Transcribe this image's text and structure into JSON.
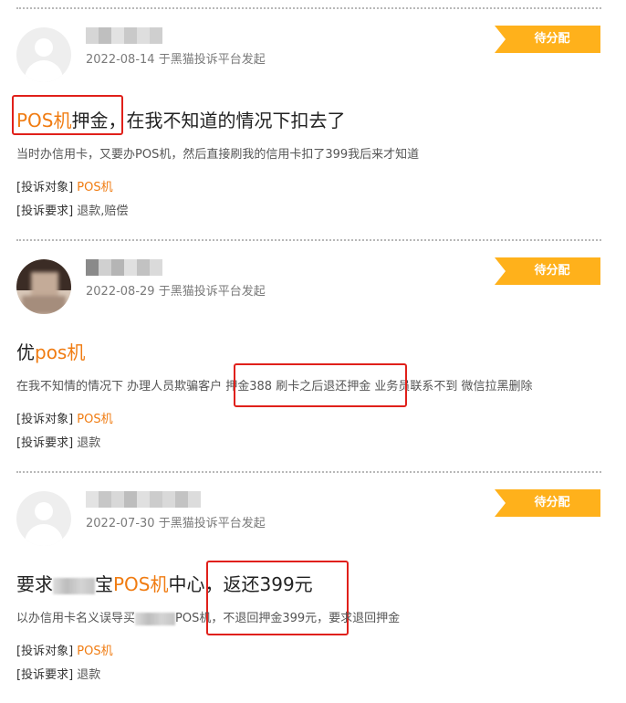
{
  "complaints": [
    {
      "status": "待分配",
      "date": "2022-08-14",
      "platform_suffix": "于黑猫投诉平台发起",
      "title_orange": "POS机",
      "title_rest": "押金，在我不知道的情况下扣去了",
      "description": "当时办信用卡，又要办POS机，然后直接刷我的信用卡扣了399我后来才知道",
      "target_label": "[投诉对象]",
      "target_value": "POS机",
      "demand_label": "[投诉要求]",
      "demand_value": "退款,赔偿"
    },
    {
      "status": "待分配",
      "date": "2022-08-29",
      "platform_suffix": "于黑猫投诉平台发起",
      "title_prefix": "优",
      "title_orange": "pos机",
      "description": "在我不知情的情况下 办理人员欺骗客户 押金388 刷卡之后退还押金 业务员联系不到 微信拉黑删除",
      "target_label": "[投诉对象]",
      "target_value": "POS机",
      "demand_label": "[投诉要求]",
      "demand_value": "退款"
    },
    {
      "status": "待分配",
      "date": "2022-07-30",
      "platform_suffix": "于黑猫投诉平台发起",
      "title_prefix": "要求",
      "title_partial": "宝",
      "title_orange": "POS机",
      "title_rest": "中心，返还399元",
      "description_part1": "以办信用卡名义误导买",
      "description_part2": "POS机，不退回押金399元，要求退回押金",
      "target_label": "[投诉对象]",
      "target_value": "POS机",
      "demand_label": "[投诉要求]",
      "demand_value": "退款"
    }
  ],
  "colors": {
    "accent": "#f07c12",
    "status_tag": "#ffb11b",
    "highlight_box": "#e0201a"
  }
}
